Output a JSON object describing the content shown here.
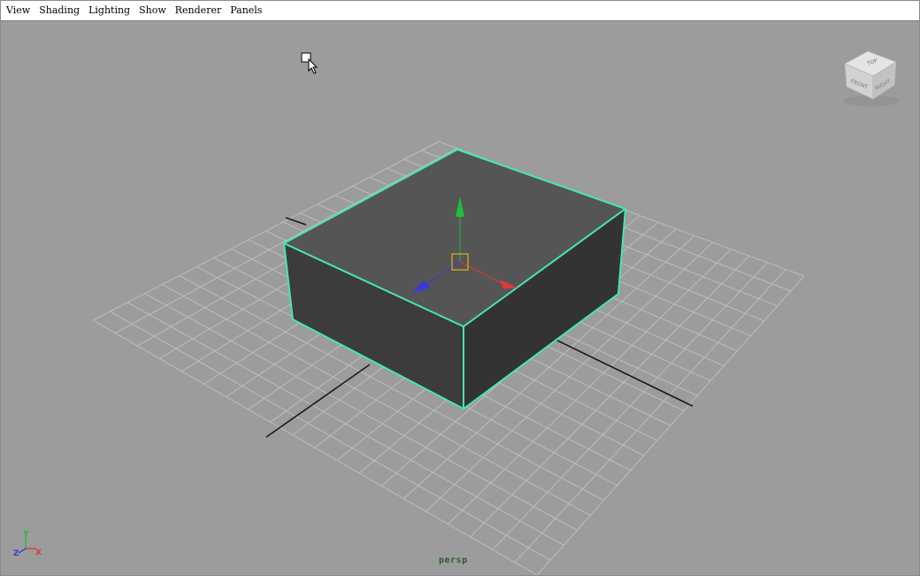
{
  "menubar": {
    "items": [
      "View",
      "Shading",
      "Lighting",
      "Show",
      "Renderer",
      "Panels"
    ]
  },
  "viewport": {
    "camera_label": "persp",
    "view_cube": {
      "top": "TOP",
      "front": "FRONT",
      "right": "RIGHT"
    },
    "axis_indicator": {
      "x": "X",
      "y": "Y",
      "z": "Z"
    },
    "colors": {
      "background": "#9c9c9c",
      "grid": "#bdbdbd",
      "selection_outline": "#44e8b0",
      "manipulator_y": "#1fbf3a",
      "manipulator_x": "#d93a3a",
      "manipulator_z": "#3a3ad9",
      "manipulator_center": "#e0b020"
    },
    "icons": [
      "cursor-select-icon",
      "view-cube-icon",
      "move-manipulator-icon",
      "axis-indicator-icon"
    ]
  }
}
